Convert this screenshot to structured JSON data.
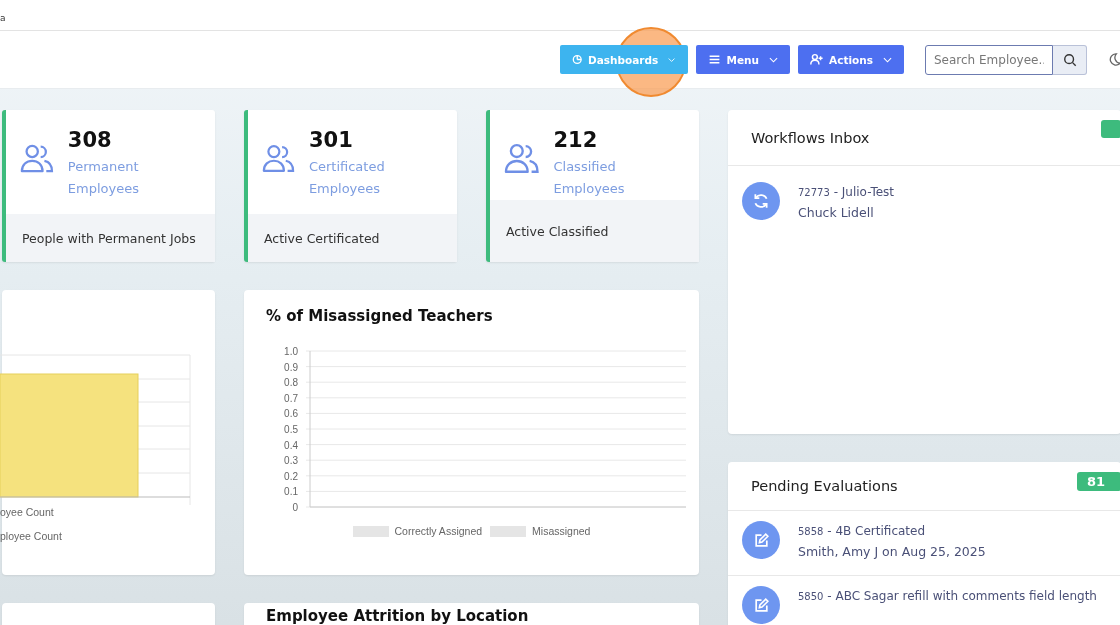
{
  "browser_tab": {
    "title": "a"
  },
  "header": {
    "buttons": [
      {
        "label": "Dashboards",
        "kind": "dashboards"
      },
      {
        "label": "Menu",
        "kind": "menu"
      },
      {
        "label": "Actions",
        "kind": "actions"
      }
    ],
    "search": {
      "placeholder": "Search Employee.."
    }
  },
  "stat_cards": [
    {
      "value": "308",
      "label": "Permanent Employees",
      "footer": "People with Permanent Jobs"
    },
    {
      "value": "301",
      "label": "Certificated Employees",
      "footer": "Active Certificated"
    },
    {
      "value": "212",
      "label": "Classified Employees",
      "footer": "Active Classified"
    }
  ],
  "left_chart": {
    "legend": [
      "oyee Count",
      "ployee Count"
    ]
  },
  "misassigned_chart": {
    "title": "% of Misassigned Teachers",
    "chart_data": {
      "type": "bar",
      "grid": true,
      "series": [
        {
          "name": "Correctly Assigned",
          "color": "#e5e5e5",
          "values": [
            null
          ]
        },
        {
          "name": "Misassigned",
          "color": "#e5e5e5",
          "values": [
            null
          ]
        }
      ],
      "ylim": [
        0,
        1
      ],
      "yticks": [
        {
          "value": 0,
          "label": "0"
        },
        {
          "value": 0.1,
          "label": "0.1"
        },
        {
          "value": 0.2,
          "label": "0.2"
        },
        {
          "value": 0.3,
          "label": "0.3"
        },
        {
          "value": 0.4,
          "label": "0.4"
        },
        {
          "value": 0.5,
          "label": "0.5"
        },
        {
          "value": 0.6,
          "label": "0.6"
        },
        {
          "value": 0.7,
          "label": "0.7"
        },
        {
          "value": 0.8,
          "label": "0.8"
        },
        {
          "value": 0.9,
          "label": "0.9"
        },
        {
          "value": 1,
          "label": "1.0"
        }
      ]
    }
  },
  "attrition_card": {
    "title": "Employee Attrition by Location"
  },
  "workflows_inbox": {
    "title": "Workflows Inbox",
    "items": [
      {
        "id": "72773",
        "title": "- Julio-Test",
        "subtitle": "Chuck Lidell"
      }
    ]
  },
  "pending_evaluations": {
    "title": "Pending Evaluations",
    "badge": "81",
    "items": [
      {
        "id": "5858",
        "title": "- 4B Certificated",
        "subtitle": "Smith, Amy J on Aug 25, 2025"
      },
      {
        "id": "5850",
        "title": "- ABC Sagar refill with comments field length"
      }
    ]
  }
}
